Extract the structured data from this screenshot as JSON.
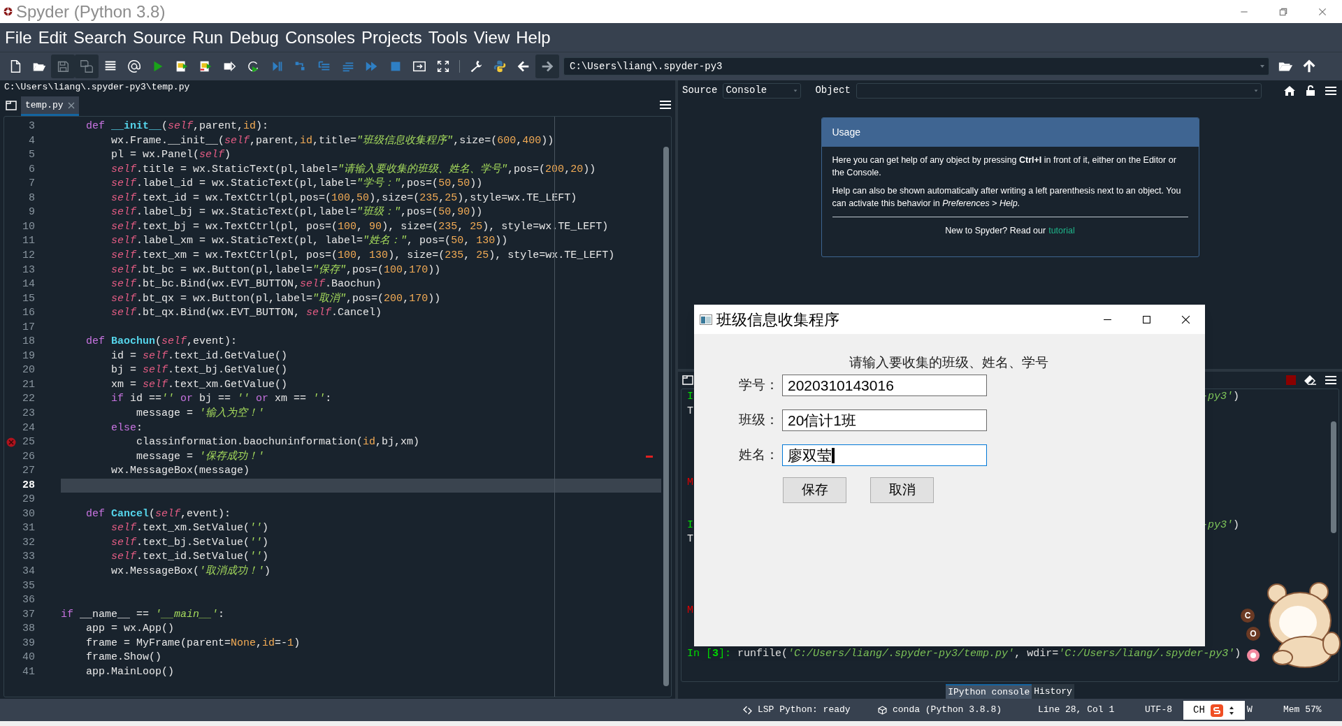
{
  "window": {
    "title": "Spyder (Python 3.8)"
  },
  "menu": [
    "File",
    "Edit",
    "Search",
    "Source",
    "Run",
    "Debug",
    "Consoles",
    "Projects",
    "Tools",
    "View",
    "Help"
  ],
  "toolbar": {
    "working_directory": "C:\\Users\\liang\\.spyder-py3"
  },
  "editor": {
    "file_path": "C:\\Users\\liang\\.spyder-py3\\temp.py",
    "tabs": [
      {
        "label": "temp.py",
        "selected": true
      }
    ],
    "lines": [
      {
        "number": "3",
        "current": false,
        "error": false,
        "tokens": [
          {
            "kind": "k",
            "text": "    def "
          },
          {
            "kind": "f",
            "text": "__init__"
          },
          {
            "kind": "p",
            "text": "("
          },
          {
            "kind": "s",
            "text": "self"
          },
          {
            "kind": "p",
            "text": ",parent,"
          },
          {
            "kind": "n",
            "text": "id"
          },
          {
            "kind": "p",
            "text": "):"
          }
        ]
      },
      {
        "number": "4",
        "current": false,
        "error": false,
        "tokens": [
          {
            "kind": "p",
            "text": "        wx.Frame.__init__("
          },
          {
            "kind": "s",
            "text": "self"
          },
          {
            "kind": "p",
            "text": ",parent,"
          },
          {
            "kind": "n",
            "text": "id"
          },
          {
            "kind": "p",
            "text": ",title="
          },
          {
            "kind": "t",
            "text": "\"班级信息收集程序\""
          },
          {
            "kind": "p",
            "text": ",size=("
          },
          {
            "kind": "n",
            "text": "600"
          },
          {
            "kind": "p",
            "text": ","
          },
          {
            "kind": "n",
            "text": "400"
          },
          {
            "kind": "p",
            "text": "))"
          }
        ]
      },
      {
        "number": "5",
        "current": false,
        "error": false,
        "tokens": [
          {
            "kind": "p",
            "text": "        pl = wx.Panel("
          },
          {
            "kind": "s",
            "text": "self"
          },
          {
            "kind": "p",
            "text": ")"
          }
        ]
      },
      {
        "number": "6",
        "current": false,
        "error": false,
        "tokens": [
          {
            "kind": "s",
            "text": "        self"
          },
          {
            "kind": "p",
            "text": ".title = wx.StaticText(pl,label="
          },
          {
            "kind": "t",
            "text": "\"请输入要收集的班级、姓名、学号\""
          },
          {
            "kind": "p",
            "text": ",pos=("
          },
          {
            "kind": "n",
            "text": "200"
          },
          {
            "kind": "p",
            "text": ","
          },
          {
            "kind": "n",
            "text": "20"
          },
          {
            "kind": "p",
            "text": "))"
          }
        ]
      },
      {
        "number": "7",
        "current": false,
        "error": false,
        "tokens": [
          {
            "kind": "s",
            "text": "        self"
          },
          {
            "kind": "p",
            "text": ".label_id = wx.StaticText(pl,label="
          },
          {
            "kind": "t",
            "text": "\"学号：\""
          },
          {
            "kind": "p",
            "text": ",pos=("
          },
          {
            "kind": "n",
            "text": "50"
          },
          {
            "kind": "p",
            "text": ","
          },
          {
            "kind": "n",
            "text": "50"
          },
          {
            "kind": "p",
            "text": "))"
          }
        ]
      },
      {
        "number": "8",
        "current": false,
        "error": false,
        "tokens": [
          {
            "kind": "s",
            "text": "        self"
          },
          {
            "kind": "p",
            "text": ".text_id = wx.TextCtrl(pl,pos=("
          },
          {
            "kind": "n",
            "text": "100"
          },
          {
            "kind": "p",
            "text": ","
          },
          {
            "kind": "n",
            "text": "50"
          },
          {
            "kind": "p",
            "text": "),size=("
          },
          {
            "kind": "n",
            "text": "235"
          },
          {
            "kind": "p",
            "text": ","
          },
          {
            "kind": "n",
            "text": "25"
          },
          {
            "kind": "p",
            "text": "),style=wx.TE_LEFT)"
          }
        ]
      },
      {
        "number": "9",
        "current": false,
        "error": false,
        "tokens": [
          {
            "kind": "s",
            "text": "        self"
          },
          {
            "kind": "p",
            "text": ".label_bj = wx.StaticText(pl,label="
          },
          {
            "kind": "t",
            "text": "\"班级：\""
          },
          {
            "kind": "p",
            "text": ",pos=("
          },
          {
            "kind": "n",
            "text": "50"
          },
          {
            "kind": "p",
            "text": ","
          },
          {
            "kind": "n",
            "text": "90"
          },
          {
            "kind": "p",
            "text": "))"
          }
        ]
      },
      {
        "number": "10",
        "current": false,
        "error": false,
        "tokens": [
          {
            "kind": "s",
            "text": "        self"
          },
          {
            "kind": "p",
            "text": ".text_bj = wx.TextCtrl(pl, pos=("
          },
          {
            "kind": "n",
            "text": "100"
          },
          {
            "kind": "p",
            "text": ", "
          },
          {
            "kind": "n",
            "text": "90"
          },
          {
            "kind": "p",
            "text": "), size=("
          },
          {
            "kind": "n",
            "text": "235"
          },
          {
            "kind": "p",
            "text": ", "
          },
          {
            "kind": "n",
            "text": "25"
          },
          {
            "kind": "p",
            "text": "), style=wx.TE_LEFT)"
          }
        ]
      },
      {
        "number": "11",
        "current": false,
        "error": false,
        "tokens": [
          {
            "kind": "s",
            "text": "        self"
          },
          {
            "kind": "p",
            "text": ".label_xm = wx.StaticText(pl, label="
          },
          {
            "kind": "t",
            "text": "\"姓名：\""
          },
          {
            "kind": "p",
            "text": ", pos=("
          },
          {
            "kind": "n",
            "text": "50"
          },
          {
            "kind": "p",
            "text": ", "
          },
          {
            "kind": "n",
            "text": "130"
          },
          {
            "kind": "p",
            "text": "))"
          }
        ]
      },
      {
        "number": "12",
        "current": false,
        "error": false,
        "tokens": [
          {
            "kind": "s",
            "text": "        self"
          },
          {
            "kind": "p",
            "text": ".text_xm = wx.TextCtrl(pl, pos=("
          },
          {
            "kind": "n",
            "text": "100"
          },
          {
            "kind": "p",
            "text": ", "
          },
          {
            "kind": "n",
            "text": "130"
          },
          {
            "kind": "p",
            "text": "), size=("
          },
          {
            "kind": "n",
            "text": "235"
          },
          {
            "kind": "p",
            "text": ", "
          },
          {
            "kind": "n",
            "text": "25"
          },
          {
            "kind": "p",
            "text": "), style=wx.TE_LEFT)"
          }
        ]
      },
      {
        "number": "13",
        "current": false,
        "error": false,
        "tokens": [
          {
            "kind": "s",
            "text": "        self"
          },
          {
            "kind": "p",
            "text": ".bt_bc = wx.Button(pl,label="
          },
          {
            "kind": "t",
            "text": "\"保存\""
          },
          {
            "kind": "p",
            "text": ",pos=("
          },
          {
            "kind": "n",
            "text": "100"
          },
          {
            "kind": "p",
            "text": ","
          },
          {
            "kind": "n",
            "text": "170"
          },
          {
            "kind": "p",
            "text": "))"
          }
        ]
      },
      {
        "number": "14",
        "current": false,
        "error": false,
        "tokens": [
          {
            "kind": "s",
            "text": "        self"
          },
          {
            "kind": "p",
            "text": ".bt_bc.Bind(wx.EVT_BUTTON,"
          },
          {
            "kind": "s",
            "text": "self"
          },
          {
            "kind": "p",
            "text": ".Baochun)"
          }
        ]
      },
      {
        "number": "15",
        "current": false,
        "error": false,
        "tokens": [
          {
            "kind": "s",
            "text": "        self"
          },
          {
            "kind": "p",
            "text": ".bt_qx = wx.Button(pl,label="
          },
          {
            "kind": "t",
            "text": "\"取消\""
          },
          {
            "kind": "p",
            "text": ",pos=("
          },
          {
            "kind": "n",
            "text": "200"
          },
          {
            "kind": "p",
            "text": ","
          },
          {
            "kind": "n",
            "text": "170"
          },
          {
            "kind": "p",
            "text": "))"
          }
        ]
      },
      {
        "number": "16",
        "current": false,
        "error": false,
        "tokens": [
          {
            "kind": "s",
            "text": "        self"
          },
          {
            "kind": "p",
            "text": ".bt_qx.Bind(wx.EVT_BUTTON, "
          },
          {
            "kind": "s",
            "text": "self"
          },
          {
            "kind": "p",
            "text": ".Cancel)"
          }
        ]
      },
      {
        "number": "17",
        "current": false,
        "error": false
      },
      {
        "number": "18",
        "current": false,
        "error": false,
        "tokens": [
          {
            "kind": "k",
            "text": "    def "
          },
          {
            "kind": "f",
            "text": "Baochun"
          },
          {
            "kind": "p",
            "text": "("
          },
          {
            "kind": "s",
            "text": "self"
          },
          {
            "kind": "p",
            "text": ",event):"
          }
        ]
      },
      {
        "number": "19",
        "current": false,
        "error": false,
        "tokens": [
          {
            "kind": "p",
            "text": "        id = "
          },
          {
            "kind": "s",
            "text": "self"
          },
          {
            "kind": "p",
            "text": ".text_id.GetValue()"
          }
        ]
      },
      {
        "number": "20",
        "current": false,
        "error": false,
        "tokens": [
          {
            "kind": "p",
            "text": "        bj = "
          },
          {
            "kind": "s",
            "text": "self"
          },
          {
            "kind": "p",
            "text": ".text_bj.GetValue()"
          }
        ]
      },
      {
        "number": "21",
        "current": false,
        "error": false,
        "tokens": [
          {
            "kind": "p",
            "text": "        xm = "
          },
          {
            "kind": "s",
            "text": "self"
          },
          {
            "kind": "p",
            "text": ".text_xm.GetValue()"
          }
        ]
      },
      {
        "number": "22",
        "current": false,
        "error": false,
        "tokens": [
          {
            "kind": "k",
            "text": "        if"
          },
          {
            "kind": "p",
            "text": " id =="
          },
          {
            "kind": "t",
            "text": "'' "
          },
          {
            "kind": "k",
            "text": "or"
          },
          {
            "kind": "p",
            "text": " bj == "
          },
          {
            "kind": "t",
            "text": "'' "
          },
          {
            "kind": "k",
            "text": "or"
          },
          {
            "kind": "p",
            "text": " xm == "
          },
          {
            "kind": "t",
            "text": "''"
          },
          {
            "kind": "p",
            "text": ":"
          }
        ]
      },
      {
        "number": "23",
        "current": false,
        "error": false,
        "tokens": [
          {
            "kind": "p",
            "text": "            message = "
          },
          {
            "kind": "t",
            "text": "'输入为空！'"
          }
        ]
      },
      {
        "number": "24",
        "current": false,
        "error": false,
        "tokens": [
          {
            "kind": "k",
            "text": "        else"
          },
          {
            "kind": "p",
            "text": ":"
          }
        ]
      },
      {
        "number": "25",
        "current": false,
        "error": true,
        "tokens": [
          {
            "kind": "p",
            "text": "            classinformation.baochuninformation("
          },
          {
            "kind": "n",
            "text": "id"
          },
          {
            "kind": "p",
            "text": ",bj,xm)"
          }
        ]
      },
      {
        "number": "26",
        "current": false,
        "error": false,
        "tokens": [
          {
            "kind": "p",
            "text": "            message = "
          },
          {
            "kind": "t",
            "text": "'保存成功！'"
          }
        ]
      },
      {
        "number": "27",
        "current": false,
        "error": false,
        "tokens": [
          {
            "kind": "p",
            "text": "        wx.MessageBox(message)"
          }
        ]
      },
      {
        "number": "28",
        "current": true,
        "error": false
      },
      {
        "number": "29",
        "current": false,
        "error": false
      },
      {
        "number": "30",
        "current": false,
        "error": false,
        "tokens": [
          {
            "kind": "k",
            "text": "    def "
          },
          {
            "kind": "f",
            "text": "Cancel"
          },
          {
            "kind": "p",
            "text": "("
          },
          {
            "kind": "s",
            "text": "self"
          },
          {
            "kind": "p",
            "text": ",event):"
          }
        ]
      },
      {
        "number": "31",
        "current": false,
        "error": false,
        "tokens": [
          {
            "kind": "s",
            "text": "        self"
          },
          {
            "kind": "p",
            "text": ".text_xm.SetValue("
          },
          {
            "kind": "t",
            "text": "''"
          },
          {
            "kind": "p",
            "text": ")"
          }
        ]
      },
      {
        "number": "32",
        "current": false,
        "error": false,
        "tokens": [
          {
            "kind": "s",
            "text": "        self"
          },
          {
            "kind": "p",
            "text": ".text_bj.SetValue("
          },
          {
            "kind": "t",
            "text": "''"
          },
          {
            "kind": "p",
            "text": ")"
          }
        ]
      },
      {
        "number": "33",
        "current": false,
        "error": false,
        "tokens": [
          {
            "kind": "s",
            "text": "        self"
          },
          {
            "kind": "p",
            "text": ".text_id.SetValue("
          },
          {
            "kind": "t",
            "text": "''"
          },
          {
            "kind": "p",
            "text": ")"
          }
        ]
      },
      {
        "number": "34",
        "current": false,
        "error": false,
        "tokens": [
          {
            "kind": "p",
            "text": "        wx.MessageBox("
          },
          {
            "kind": "t",
            "text": "'取消成功！'"
          },
          {
            "kind": "p",
            "text": ")"
          }
        ]
      },
      {
        "number": "35",
        "current": false,
        "error": false
      },
      {
        "number": "36",
        "current": false,
        "error": false
      },
      {
        "number": "37",
        "current": false,
        "error": false,
        "tokens": [
          {
            "kind": "k",
            "text": "if"
          },
          {
            "kind": "p",
            "text": " __name__ == "
          },
          {
            "kind": "t",
            "text": "'__main__'"
          },
          {
            "kind": "p",
            "text": ":"
          }
        ]
      },
      {
        "number": "38",
        "current": false,
        "error": false,
        "tokens": [
          {
            "kind": "p",
            "text": "    app = wx.App()"
          }
        ]
      },
      {
        "number": "39",
        "current": false,
        "error": false,
        "tokens": [
          {
            "kind": "p",
            "text": "    frame = MyFrame(parent="
          },
          {
            "kind": "n",
            "text": "None"
          },
          {
            "kind": "p",
            "text": ","
          },
          {
            "kind": "n",
            "text": "id"
          },
          {
            "kind": "p",
            "text": "=-"
          },
          {
            "kind": "n",
            "text": "1"
          },
          {
            "kind": "p",
            "text": ")"
          }
        ]
      },
      {
        "number": "40",
        "current": false,
        "error": false,
        "tokens": [
          {
            "kind": "p",
            "text": "    frame.Show()"
          }
        ]
      },
      {
        "number": "41",
        "current": false,
        "error": false,
        "tokens": [
          {
            "kind": "p",
            "text": "    app.MainLoop()"
          }
        ]
      }
    ]
  },
  "help": {
    "source_label": "Source",
    "source_value": "Console",
    "object_label": "Object",
    "card": {
      "title": "Usage",
      "paragraphs": [
        "Here you can get help of any object by pressing **Ctrl+I** in front of it, either on the Editor or the Console.",
        "Help can also be shown automatically after writing a left parenthesis next to an object. You can activate this behavior in *Preferences > Help*."
      ],
      "footer_text": "New to Spyder? Read our",
      "footer_link": "tutorial"
    }
  },
  "console": {
    "lines": [
      {
        "kind": "text",
        "tokens": [
          {
            "kind": "g",
            "text": "I"
          }
        ],
        "right": [
          {
            "kind": "t",
            "text": "-py3'"
          },
          {
            "kind": "w",
            "text": ")"
          }
        ]
      },
      {
        "kind": "text",
        "tokens": [
          {
            "kind": "w",
            "text": "T"
          }
        ]
      },
      {
        "kind": "blank"
      },
      {
        "kind": "blank"
      },
      {
        "kind": "blank"
      },
      {
        "kind": "blank"
      },
      {
        "kind": "text",
        "tokens": [
          {
            "kind": "r",
            "text": "M"
          }
        ]
      },
      {
        "kind": "blank"
      },
      {
        "kind": "blank"
      },
      {
        "kind": "text",
        "tokens": [
          {
            "kind": "g",
            "text": "I"
          }
        ],
        "right": [
          {
            "kind": "t",
            "text": "-py3'"
          },
          {
            "kind": "w",
            "text": ")"
          }
        ]
      },
      {
        "kind": "text",
        "tokens": [
          {
            "kind": "w",
            "text": "T"
          }
        ]
      },
      {
        "kind": "blank"
      },
      {
        "kind": "blank"
      },
      {
        "kind": "blank"
      },
      {
        "kind": "blank"
      },
      {
        "kind": "text",
        "tokens": [
          {
            "kind": "r",
            "text": "M"
          }
        ]
      },
      {
        "kind": "blank"
      },
      {
        "kind": "blank"
      },
      {
        "kind": "text",
        "tokens": [
          {
            "kind": "g",
            "text": "In ["
          },
          {
            "kind": "gb",
            "text": "3"
          },
          {
            "kind": "g",
            "text": "]: "
          },
          {
            "kind": "w",
            "text": "runfile("
          },
          {
            "kind": "t",
            "text": "'C:/Users/liang/.spyder-py3/temp.py'"
          },
          {
            "kind": "w",
            "text": ", wdir="
          },
          {
            "kind": "t",
            "text": "'C:/Users/liang/.spyder-py3'"
          },
          {
            "kind": "w",
            "text": ")"
          }
        ]
      }
    ],
    "tabs": [
      {
        "label": "IPython console",
        "selected": true
      },
      {
        "label": "History",
        "selected": false
      }
    ]
  },
  "dialog": {
    "title": "班级信息收集程序",
    "heading": "请输入要收集的班级、姓名、学号",
    "fields": [
      {
        "label": "学号：",
        "value": "2020310143016",
        "focused": false
      },
      {
        "label": "班级：",
        "value": "20信计1班",
        "focused": false
      },
      {
        "label": "姓名：",
        "value": "廖双莹",
        "focused": true
      }
    ],
    "buttons": [
      "保存",
      "取消"
    ]
  },
  "status": {
    "items": [
      {
        "kind": "lsp",
        "text": "LSP Python: ready"
      },
      {
        "kind": "conda",
        "text": "conda (Python 3.8.8)"
      },
      {
        "kind": "plain",
        "text": "Line 28, Col 1"
      },
      {
        "kind": "plain",
        "text": "UTF-8"
      },
      {
        "kind": "plain",
        "text": "W"
      },
      {
        "kind": "plain",
        "text": "Mem 57%"
      }
    ]
  },
  "ime": {
    "label": "CH"
  },
  "sticker": {
    "badges": [
      "C",
      "O"
    ]
  }
}
